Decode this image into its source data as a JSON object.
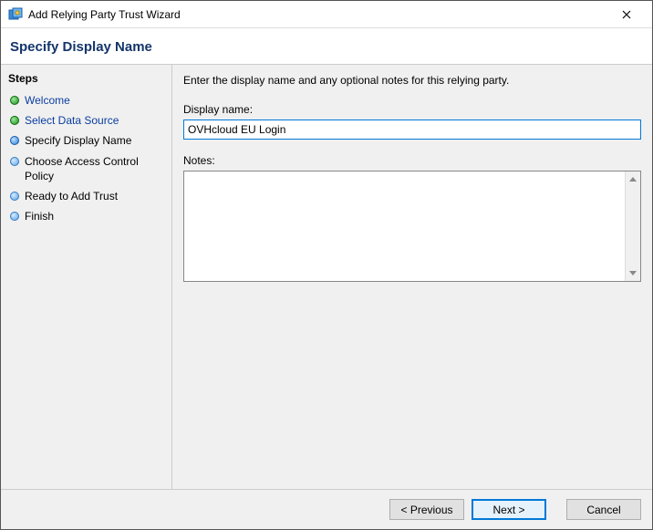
{
  "window": {
    "title": "Add Relying Party Trust Wizard"
  },
  "header": {
    "title": "Specify Display Name"
  },
  "sidebar": {
    "label": "Steps",
    "items": [
      {
        "label": "Welcome",
        "state": "done",
        "link": true
      },
      {
        "label": "Select Data Source",
        "state": "done",
        "link": true
      },
      {
        "label": "Specify Display Name",
        "state": "current",
        "link": false
      },
      {
        "label": "Choose Access Control Policy",
        "state": "future",
        "link": false
      },
      {
        "label": "Ready to Add Trust",
        "state": "future",
        "link": false
      },
      {
        "label": "Finish",
        "state": "future",
        "link": false
      }
    ]
  },
  "content": {
    "instruction": "Enter the display name and any optional notes for this relying party.",
    "display_name_label": "Display name:",
    "display_name_value": "OVHcloud EU Login",
    "notes_label": "Notes:",
    "notes_value": ""
  },
  "footer": {
    "previous": "< Previous",
    "next": "Next >",
    "cancel": "Cancel"
  }
}
